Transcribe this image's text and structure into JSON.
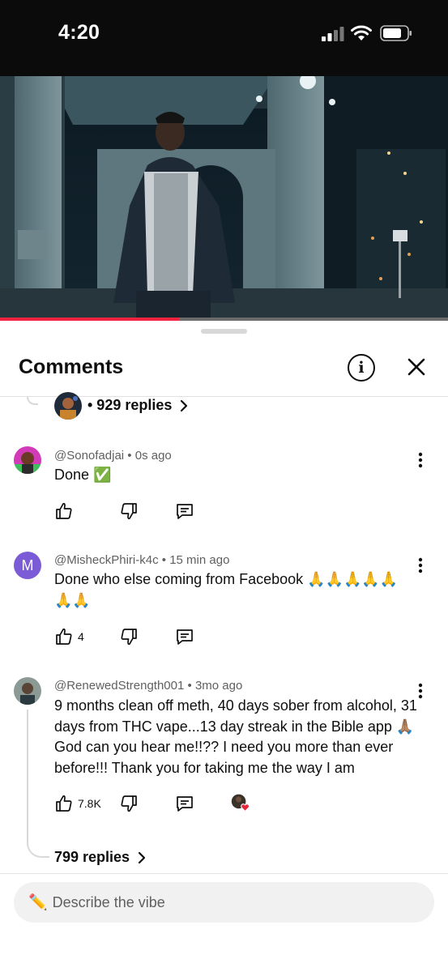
{
  "status_bar": {
    "time": "4:20"
  },
  "video": {
    "progress_fraction": 0.4
  },
  "comments_panel": {
    "title": "Comments",
    "previous_thread": {
      "replies_label": "• 929 replies"
    },
    "comments": [
      {
        "author": "@Sonofadjai",
        "age": "0s ago",
        "text": "Done ✅",
        "likes": "",
        "avatar_letter": ""
      },
      {
        "author": "@MisheckPhiri-k4c",
        "age": "15 min ago",
        "text": "Done who else coming from Facebook 🙏🙏🙏🙏🙏🙏🙏",
        "likes": "4",
        "avatar_letter": "M"
      },
      {
        "author": "@RenewedStrength001",
        "age": "3mo ago",
        "text": "9 months clean off meth, 40 days sober from alcohol, 31 days from THC vape...13 day streak in the Bible app 🙏🏽 God can you hear me!!?? I need you more than ever before!!! Thank you for taking me the way I am",
        "likes": "7.8K",
        "avatar_letter": "",
        "replies_label": "799 replies"
      }
    ],
    "separator": "•"
  },
  "comment_input": {
    "placeholder": "Describe the vibe",
    "value": "",
    "icon": "pencil-icon"
  },
  "colors": {
    "accent": "#f2233f",
    "avatar_m": "#7b5cd6",
    "heart": "#e8243a"
  }
}
